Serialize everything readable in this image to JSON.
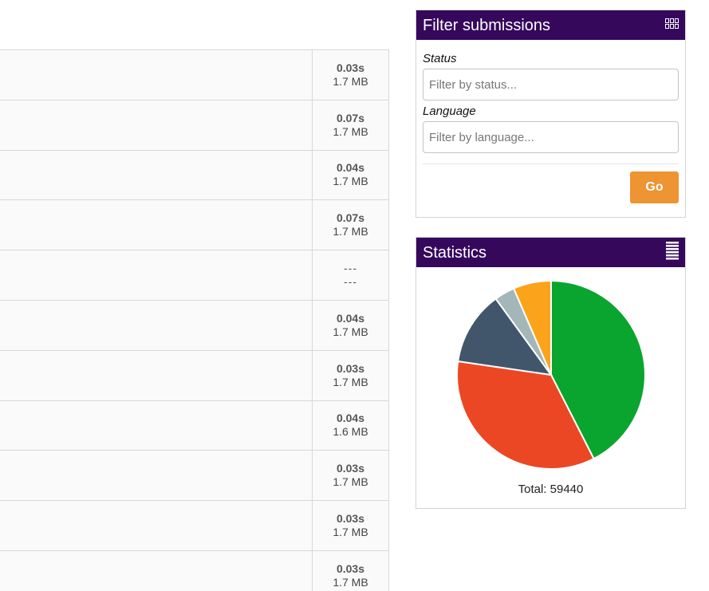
{
  "submissions": [
    {
      "time": "0.03s",
      "memory": "1.7 MB"
    },
    {
      "time": "0.07s",
      "memory": "1.7 MB"
    },
    {
      "time": "0.04s",
      "memory": "1.7 MB"
    },
    {
      "time": "0.07s",
      "memory": "1.7 MB"
    },
    {
      "time": "---",
      "memory": "---"
    },
    {
      "time": "0.04s",
      "memory": "1.7 MB"
    },
    {
      "time": "0.03s",
      "memory": "1.7 MB"
    },
    {
      "time": "0.04s",
      "memory": "1.6 MB"
    },
    {
      "time": "0.03s",
      "memory": "1.7 MB"
    },
    {
      "time": "0.03s",
      "memory": "1.7 MB"
    },
    {
      "time": "0.03s",
      "memory": "1.7 MB"
    }
  ],
  "filter": {
    "title": "Filter submissions",
    "icon": "grid-icon",
    "status_label": "Status",
    "status_placeholder": "Filter by status...",
    "language_label": "Language",
    "language_placeholder": "Filter by language...",
    "go_label": "Go",
    "accent_color": "#ee9433"
  },
  "statistics": {
    "title": "Statistics",
    "icon": "list-icon",
    "total_label": "Total: 59440",
    "header_color": "#35085c"
  },
  "chart_data": {
    "type": "pie",
    "title": "",
    "slices": [
      {
        "value": 42.5,
        "color": "#0aa52e"
      },
      {
        "value": 34.8,
        "color": "#ec4724"
      },
      {
        "value": 12.7,
        "color": "#42566b"
      },
      {
        "value": 3.5,
        "color": "#a3b6b8"
      },
      {
        "value": 6.5,
        "color": "#fba31a"
      }
    ],
    "total": 59440
  }
}
